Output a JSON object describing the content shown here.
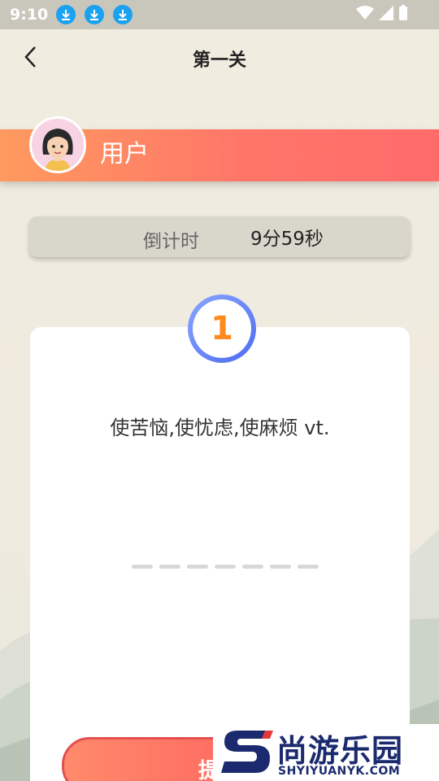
{
  "status_bar": {
    "time": "9:10"
  },
  "header": {
    "title": "第一关"
  },
  "user": {
    "name": "用户"
  },
  "timer": {
    "label": "倒计时",
    "value": "9分59秒"
  },
  "quiz": {
    "number": "1",
    "prompt": "使苦恼,使忧虑,使麻烦 vt.",
    "blank_count": 7
  },
  "submit": {
    "label": "提"
  },
  "watermark": {
    "brand": "尚游乐园",
    "url": "SHYIYUANYK.COM"
  },
  "colors": {
    "accent": "#ff6b6b",
    "badge_ring": "#4c6cf0",
    "number": "#ff8a1e"
  }
}
